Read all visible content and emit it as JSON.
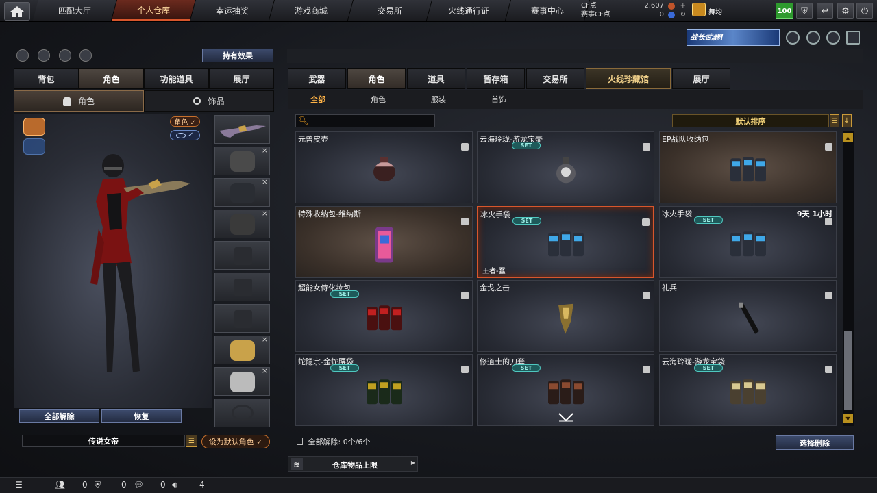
{
  "nav": {
    "tabs": [
      "匹配大厅",
      "个人仓库",
      "幸运抽奖",
      "游戏商城",
      "交易所",
      "火线通行证",
      "赛事中心"
    ],
    "active_index": 1
  },
  "currency": {
    "cf_label": "CF点",
    "cf_value": "2,607",
    "event_label": "赛事CF点",
    "event_value": "0"
  },
  "user": {
    "name": "舞均",
    "level": "100"
  },
  "banner": {
    "text": "战长武器!"
  },
  "left": {
    "effect_button": "持有效果",
    "tabs": [
      "背包",
      "角色",
      "功能道具",
      "展厅"
    ],
    "active_tab": 1,
    "subtabs": [
      "角色",
      "饰品"
    ],
    "visibility_role": "角色 ✓",
    "visibility_eye": "✓",
    "unequip_all": "全部解除",
    "restore": "恢复",
    "character_name": "传说女帝",
    "set_default": "设为默认角色 ✓"
  },
  "right": {
    "tabs": [
      "武器",
      "角色",
      "道具",
      "暂存箱",
      "交易所",
      "火线珍藏馆",
      "展厅"
    ],
    "active_tab": 1,
    "filters": [
      "全部",
      "角色",
      "服装",
      "首饰"
    ],
    "active_filter": 0,
    "search_placeholder": "",
    "sort_label": "默认排序",
    "items": [
      {
        "name": "元兽皮壶",
        "set": "",
        "timer": "",
        "owner": "",
        "art": "pot"
      },
      {
        "name": "云海玲珑-游龙宝壶",
        "set": "SET",
        "timer": "",
        "owner": "",
        "art": "flask"
      },
      {
        "name": "EP战队收纳包",
        "set": "",
        "timer": "",
        "owner": "",
        "art": "mag-blue"
      },
      {
        "name": "特殊收纳包-维纳斯",
        "set": "",
        "timer": "",
        "owner": "",
        "art": "bag-pink"
      },
      {
        "name": "冰火手袋",
        "set": "SET",
        "timer": "",
        "owner": "王者-蠢",
        "art": "mag-blue"
      },
      {
        "name": "冰火手袋",
        "set": "SET",
        "timer": "9天 1小时",
        "owner": "",
        "art": "mag-blue"
      },
      {
        "name": "超能女侍化妆包",
        "set": "SET",
        "timer": "",
        "owner": "",
        "art": "mag-red"
      },
      {
        "name": "金戈之击",
        "set": "",
        "timer": "",
        "owner": "",
        "art": "holster"
      },
      {
        "name": "礼兵",
        "set": "",
        "timer": "",
        "owner": "",
        "art": "baton"
      },
      {
        "name": "蛇隐宗-金蛇腰袋",
        "set": "SET",
        "timer": "",
        "owner": "",
        "art": "mag-green"
      },
      {
        "name": "修道士的刀套",
        "set": "SET",
        "timer": "",
        "owner": "",
        "art": "mag-dark"
      },
      {
        "name": "云海玲珑-游龙宝袋",
        "set": "SET",
        "timer": "",
        "owner": "",
        "art": "mag-gold"
      }
    ],
    "unequip_count": "全部解除: 0个/6个",
    "select_delete": "选择删除",
    "storage_cap": "仓库物品上限"
  },
  "bottom": {
    "friends": "0",
    "guild": "0",
    "chat": "0",
    "volume": "4"
  }
}
